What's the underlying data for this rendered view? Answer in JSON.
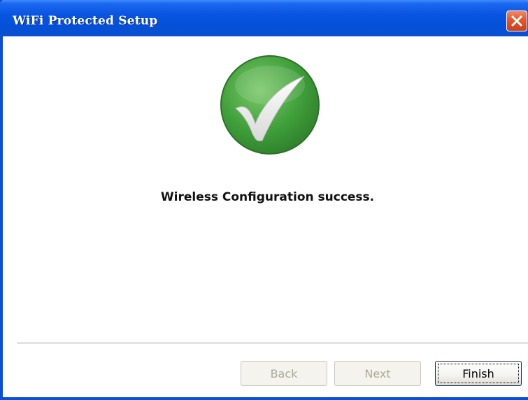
{
  "window": {
    "title": "WiFi Protected Setup"
  },
  "content": {
    "icon": "checkmark-icon",
    "message": "Wireless Configuration success."
  },
  "buttons": {
    "back_label": "Back",
    "next_label": "Next",
    "finish_label": "Finish",
    "back_enabled": false,
    "next_enabled": false,
    "finish_enabled": true
  },
  "colors": {
    "titlebar": "#0a55e0",
    "close_button": "#e2562a",
    "success_green": "#3ea03a"
  }
}
